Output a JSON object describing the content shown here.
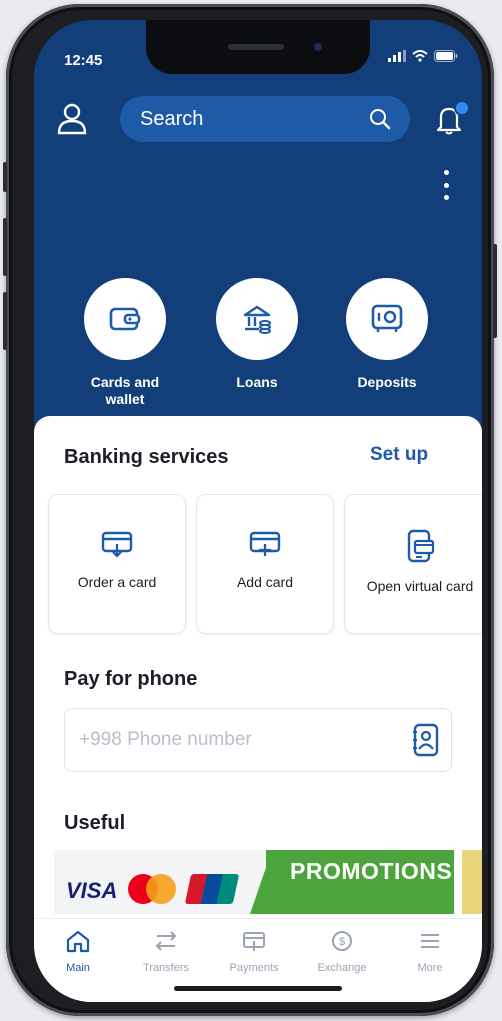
{
  "status": {
    "time": "12:45"
  },
  "header": {
    "search_placeholder": "Search"
  },
  "quick_actions": [
    {
      "label": "Cards and wallet",
      "icon": "wallet-icon"
    },
    {
      "label": "Loans",
      "icon": "bank-coins-icon"
    },
    {
      "label": "Deposits",
      "icon": "safe-icon"
    }
  ],
  "banking_services": {
    "title": "Banking services",
    "action": "Set up",
    "items": [
      {
        "label": "Order a card",
        "icon": "card-download-icon"
      },
      {
        "label": "Add card",
        "icon": "card-add-icon"
      },
      {
        "label": "Open virtual card",
        "icon": "virtual-card-icon"
      }
    ]
  },
  "pay_phone": {
    "title": "Pay for phone",
    "placeholder": "+998 Phone number"
  },
  "useful": {
    "title": "Useful",
    "visa": "VISA",
    "unionpay": "UnionPay",
    "promo": "PROMOTIONS"
  },
  "colors": {
    "brand_blue": "#123f7a",
    "accent_blue": "#1f5aa6",
    "promo_green": "#4ba53c"
  },
  "tabs": [
    {
      "label": "Main",
      "icon": "home-icon",
      "active": true
    },
    {
      "label": "Transfers",
      "icon": "transfer-icon",
      "active": false
    },
    {
      "label": "Payments",
      "icon": "payments-icon",
      "active": false
    },
    {
      "label": "Exchange",
      "icon": "exchange-icon",
      "active": false
    },
    {
      "label": "More",
      "icon": "menu-icon",
      "active": false
    }
  ]
}
